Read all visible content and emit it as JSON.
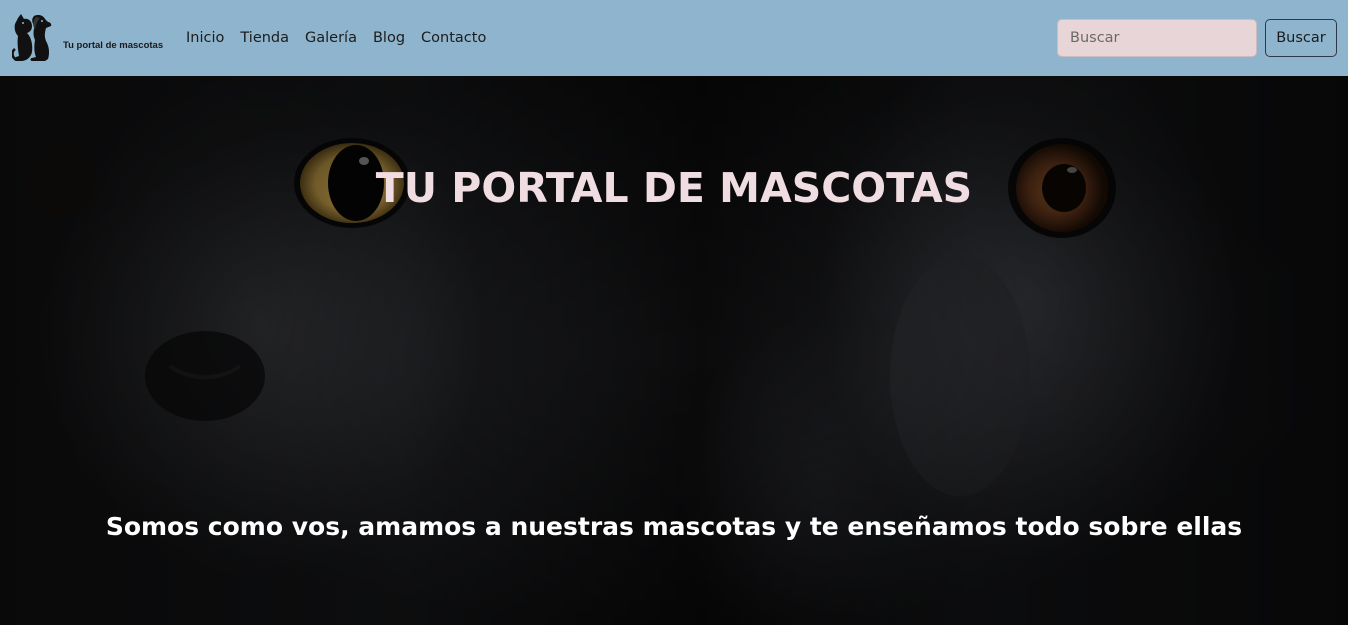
{
  "brand": {
    "logo_icon": "dog-and-cat-logo-icon",
    "name": "Tu portal de mascotas"
  },
  "nav": {
    "items": [
      {
        "label": "Inicio"
      },
      {
        "label": "Tienda"
      },
      {
        "label": "Galería"
      },
      {
        "label": "Blog"
      },
      {
        "label": "Contacto"
      }
    ]
  },
  "search": {
    "placeholder": "Buscar",
    "button_label": "Buscar"
  },
  "hero": {
    "title": "TU PORTAL DE MASCOTAS",
    "subtitle": "Somos como vos, amamos a nuestras mascotas y te enseñamos todo sobre ellas",
    "image": "black-cat-and-black-dog-closeup-photo"
  },
  "colors": {
    "navbar_bg": "#8fb4cd",
    "search_input_bg": "#e8d5d8",
    "hero_title": "#f0dde2",
    "cat_eye": "#c9a24a",
    "dog_eye": "#6b3a1c"
  }
}
